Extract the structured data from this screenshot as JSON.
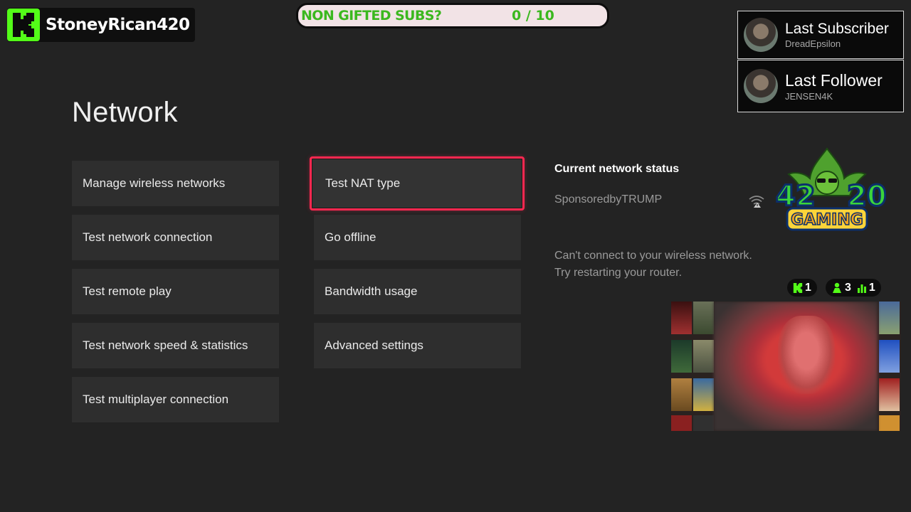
{
  "overlay": {
    "channel_name": "StoneyRican420",
    "sub_goal": {
      "label": "NON GIFTED SUBS?",
      "count": "0 / 10"
    },
    "last_subscriber": {
      "title": "Last Subscriber",
      "name": "DreadEpsilon"
    },
    "last_follower": {
      "title": "Last Follower",
      "name": "JENSEN4K"
    },
    "logo_text": {
      "top": "42",
      "right": "20",
      "bottom": "GAMING"
    },
    "stats": {
      "kick": "1",
      "followers": "3",
      "viewers": "1"
    },
    "colors": {
      "kick_green": "#53fc18",
      "focus_red": "#ff2850"
    }
  },
  "page": {
    "title": "Network",
    "left_column": [
      "Manage wireless networks",
      "Test network connection",
      "Test remote play",
      "Test network speed & statistics",
      "Test multiplayer connection"
    ],
    "right_column": [
      "Test NAT type",
      "Go offline",
      "Bandwidth usage",
      "Advanced settings"
    ],
    "status": {
      "heading": "Current network status",
      "network_name": "SponsoredbyTRUMP",
      "message": "Can't connect to your wireless network. Try restarting your router."
    }
  }
}
